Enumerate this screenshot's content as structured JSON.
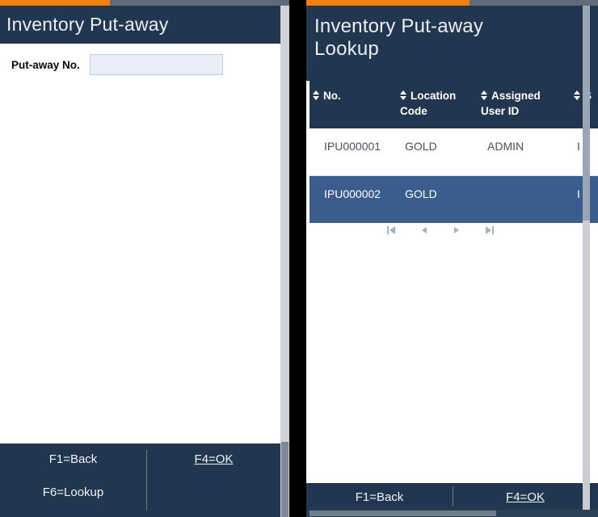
{
  "left_panel": {
    "progress_percent": 38,
    "title": "Inventory Put-away",
    "form": {
      "label": "Put-away No.",
      "value": "",
      "placeholder": ""
    },
    "footer": {
      "keys_left": [
        "F1=Back",
        "F6=Lookup"
      ],
      "keys_right": [
        "F4=OK"
      ]
    }
  },
  "right_panel": {
    "progress_percent": 56,
    "title": "Inventory Put-away Lookup",
    "table": {
      "columns": [
        {
          "label": "No.",
          "sortable": true
        },
        {
          "label": "Location Code",
          "sortable": true
        },
        {
          "label": "Assigned User ID",
          "sortable": true
        },
        {
          "label": "S",
          "sortable": true
        }
      ],
      "rows": [
        {
          "no": "IPU000001",
          "location_code": "GOLD",
          "assigned_user_id": "ADMIN",
          "col4": "I",
          "selected": false
        },
        {
          "no": "IPU000002",
          "location_code": "GOLD",
          "assigned_user_id": "",
          "col4": "I",
          "selected": true
        }
      ]
    },
    "pager": {
      "first_label": "first-page",
      "prev_label": "previous-page",
      "next_label": "next-page",
      "last_label": "last-page"
    },
    "footer": {
      "keys_left": [
        "F1=Back"
      ],
      "keys_right": [
        "F4=OK"
      ]
    }
  },
  "colors": {
    "header_navy": "#22374f",
    "accent_orange": "#f28011",
    "selected_row": "#3b5d8d",
    "input_fill": "#e8edf7",
    "pager_icon": "#9fb2c6"
  }
}
